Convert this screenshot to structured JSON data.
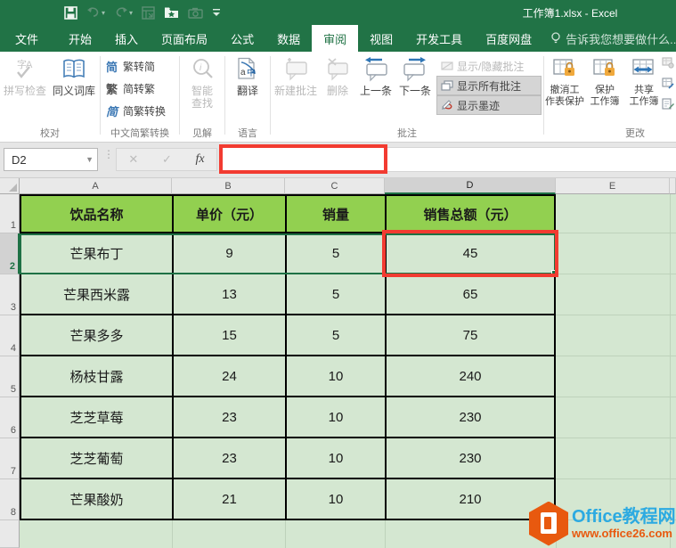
{
  "window": {
    "title": "工作簿1.xlsx - Excel"
  },
  "qat": {
    "icons": [
      "save-icon",
      "undo-icon",
      "redo-icon",
      "preview-icon",
      "folder-star-icon",
      "camera-icon",
      "customize-qat-icon"
    ]
  },
  "tabs": {
    "items": [
      "文件",
      "开始",
      "插入",
      "页面布局",
      "公式",
      "数据",
      "审阅",
      "视图",
      "开发工具",
      "百度网盘"
    ],
    "active": "审阅",
    "tell_me": "告诉我您想要做什么..."
  },
  "ribbon": {
    "proofing": {
      "label": "校对",
      "spell_check": "拼写检查",
      "thesaurus": "同义词库"
    },
    "chinese_conversion": {
      "label": "中文简繁转换",
      "icons": [
        "简",
        "繁",
        "简"
      ],
      "items": [
        "繁转简",
        "简转繁",
        "简繁转换"
      ]
    },
    "insights": {
      "label": "见解",
      "smart_l1": "智能",
      "smart_l2": "查找"
    },
    "language": {
      "label": "语言",
      "translate": "翻译"
    },
    "comments": {
      "label": "批注",
      "new_comment": "新建批注",
      "delete": "删除",
      "previous": "上一条",
      "next": "下一条",
      "show_hide": "显示/隐藏批注",
      "show_all": "显示所有批注",
      "show_ink": "显示墨迹"
    },
    "changes": {
      "label": "更改",
      "unprotect_l1": "撤消工",
      "unprotect_l2": "作表保护",
      "protect_l1": "保护",
      "protect_l2": "工作簿",
      "share_l1": "共享",
      "share_l2": "工作簿"
    }
  },
  "formula_bar": {
    "name_box": "D2",
    "cancel_icon": "✕",
    "enter_icon": "✓",
    "fx_label": "fx",
    "formula": ""
  },
  "sheet": {
    "col_headers": [
      "A",
      "B",
      "C",
      "D",
      "E"
    ],
    "row_numbers": [
      "1",
      "2",
      "3",
      "4",
      "5",
      "6",
      "7",
      "8"
    ],
    "header_row": [
      "饮品名称",
      "单价（元）",
      "销量",
      "销售总额（元）"
    ],
    "rows": [
      [
        "芒果布丁",
        "9",
        "5",
        "45"
      ],
      [
        "芒果西米露",
        "13",
        "5",
        "65"
      ],
      [
        "芒果多多",
        "15",
        "5",
        "75"
      ],
      [
        "杨枝甘露",
        "24",
        "10",
        "240"
      ],
      [
        "芝芝草莓",
        "23",
        "10",
        "230"
      ],
      [
        "芝芝葡萄",
        "23",
        "10",
        "230"
      ],
      [
        "芒果酸奶",
        "21",
        "10",
        "210"
      ]
    ],
    "active_cell": "D2"
  },
  "watermark": {
    "brand": "Office教程网",
    "url": "www.office26.com"
  },
  "colors": {
    "excel_green": "#217346",
    "table_header_green": "#92d050",
    "table_body_green": "#d4e7d1",
    "annotation_red": "#f23b31",
    "lock_orange": "#f0a93c",
    "arrow_blue": "#2e75b6"
  }
}
